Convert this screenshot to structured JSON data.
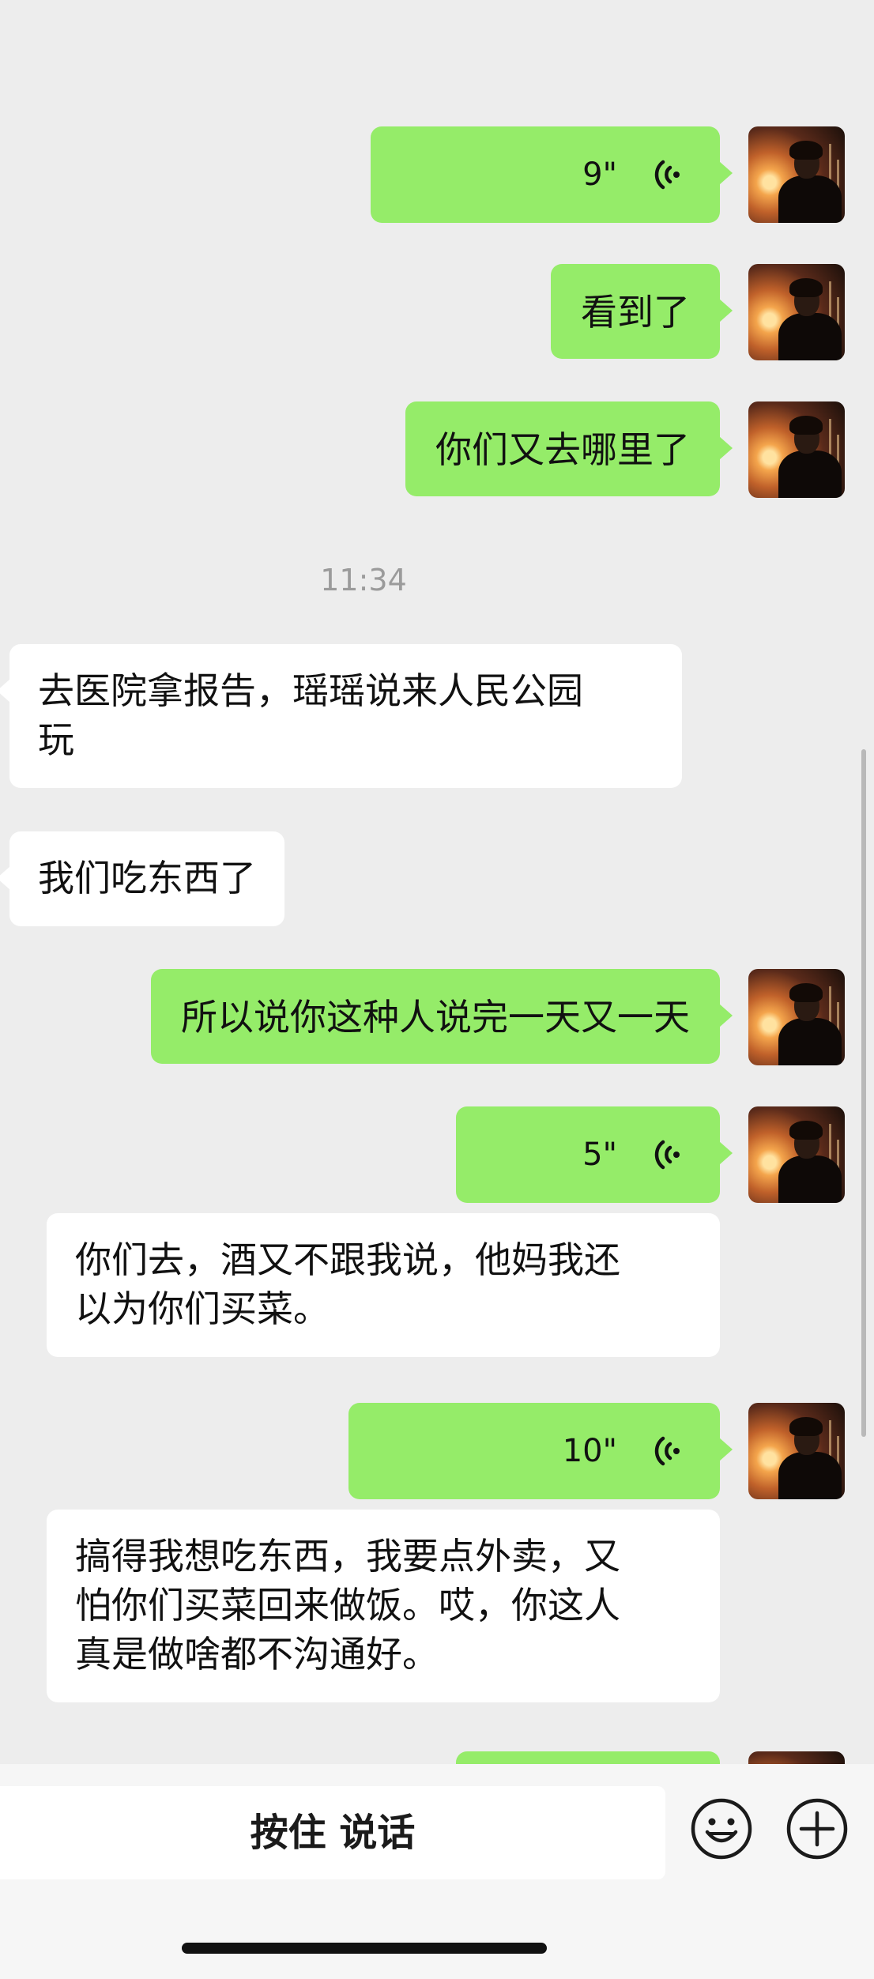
{
  "messages": [
    {
      "side": "right",
      "type": "voice",
      "duration": "9\""
    },
    {
      "side": "right",
      "type": "text",
      "text": "看到了"
    },
    {
      "side": "right",
      "type": "text",
      "text": "你们又去哪里了"
    },
    {
      "type": "timestamp",
      "text": "11:34"
    },
    {
      "side": "left",
      "type": "text",
      "lines": [
        "去医院拿报告，瑶瑶说来人民公园",
        "玩"
      ]
    },
    {
      "side": "left",
      "type": "text",
      "text": "我们吃东西了"
    },
    {
      "side": "right",
      "type": "text",
      "text": "所以说你这种人说完一天又一天"
    },
    {
      "side": "right",
      "type": "voice",
      "duration": "5\""
    },
    {
      "side": "left",
      "type": "text",
      "lines": [
        "你们去，酒又不跟我说，他妈我还",
        "以为你们买菜。"
      ]
    },
    {
      "side": "right",
      "type": "voice",
      "duration": "10\""
    },
    {
      "side": "left",
      "type": "text",
      "lines": [
        "搞得我想吃东西，我要点外卖，又",
        "怕你们买菜回来做饭。哎，你这人",
        "真是做啥都不沟通好。"
      ]
    }
  ],
  "input_bar": {
    "hold_to_talk_label": "按住 说话",
    "emoji_icon": "emoji-icon",
    "plus_icon": "plus-icon"
  },
  "colors": {
    "sent_bubble": "#95ec69",
    "received_bubble": "#ffffff",
    "background": "#ededed"
  }
}
